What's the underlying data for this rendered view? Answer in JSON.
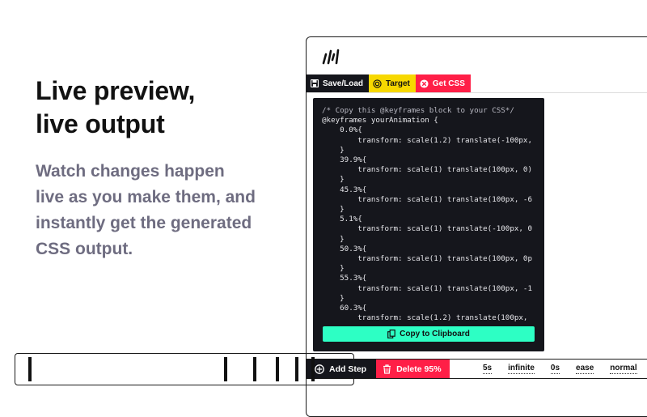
{
  "hero": {
    "headline_line1": "Live preview,",
    "headline_line2": "live output",
    "description_lines": [
      "Watch changes happen",
      "live as you make them, and",
      "instantly get the generated",
      "CSS output."
    ]
  },
  "toolbar": {
    "save_load": "Save/Load",
    "target": "Target",
    "get_css": "Get CSS"
  },
  "code": {
    "comment": "/* Copy this @keyframes block to your CSS*/",
    "lines": [
      "@keyframes yourAnimation {",
      "    0.0%{",
      "        transform: scale(1.2) translate(-100px, ",
      "    }",
      "    39.9%{",
      "        transform: scale(1) translate(100px, 0)",
      "    }",
      "    45.3%{",
      "        transform: scale(1) translate(100px, -6",
      "    }",
      "    5.1%{",
      "        transform: scale(1) translate(-100px, 0",
      "    }",
      "    50.3%{",
      "        transform: scale(1) translate(100px, 0p",
      "    }",
      "    55.3%{",
      "        transform: scale(1) translate(100px, -1",
      "    }",
      "    60.3%{",
      "        transform: scale(1.2) translate(100px, "
    ],
    "copy_label": "Copy to Clipboard"
  },
  "steps": {
    "add_label": "Add Step",
    "delete_label": "Delete 95%"
  },
  "animation_settings": {
    "duration": "5s",
    "iterations": "infinite",
    "delay": "0s",
    "easing": "ease",
    "direction": "normal"
  },
  "colors": {
    "dark": "#15161c",
    "accent_yellow": "#f7d800",
    "accent_red": "#ff1f47",
    "accent_mint": "#2dffc4",
    "subtext": "#6e6c80"
  }
}
